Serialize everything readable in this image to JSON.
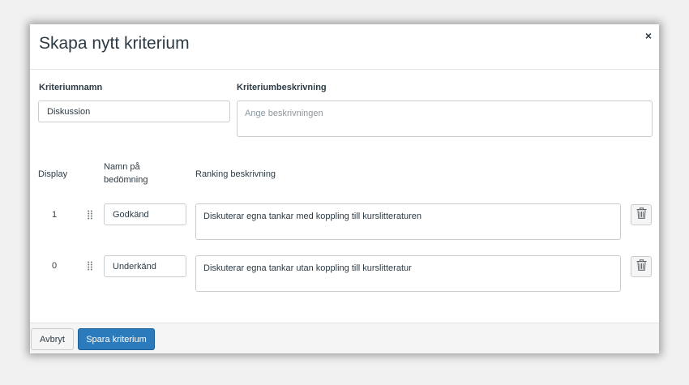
{
  "modal": {
    "title": "Skapa nytt kriterium",
    "close_label": "×"
  },
  "criterion": {
    "name_label": "Kriteriumnamn",
    "name_value": "Diskussion",
    "description_label": "Kriteriumbeskrivning",
    "description_placeholder": "Ange beskrivningen",
    "description_value": ""
  },
  "columns": {
    "display": "Display",
    "rating_name": "Namn på bedömning",
    "rating_description": "Ranking beskrivning"
  },
  "ratings": [
    {
      "points": "1",
      "name": "Godkänd",
      "description": "Diskuterar egna tankar med koppling till kurslitteraturen"
    },
    {
      "points": "0",
      "name": "Underkänd",
      "description": "Diskuterar egna tankar utan koppling till kurslitteratur"
    }
  ],
  "footer": {
    "cancel_label": "Avbryt",
    "save_label": "Spara kriterium"
  },
  "colors": {
    "primary": "#2b7abc",
    "text": "#2d3b45",
    "border": "#c7cdd1",
    "footer_bg": "#f5f5f5"
  },
  "icons": {
    "close": "close-icon",
    "drag": "drag-handle-icon",
    "delete": "trash-icon"
  }
}
